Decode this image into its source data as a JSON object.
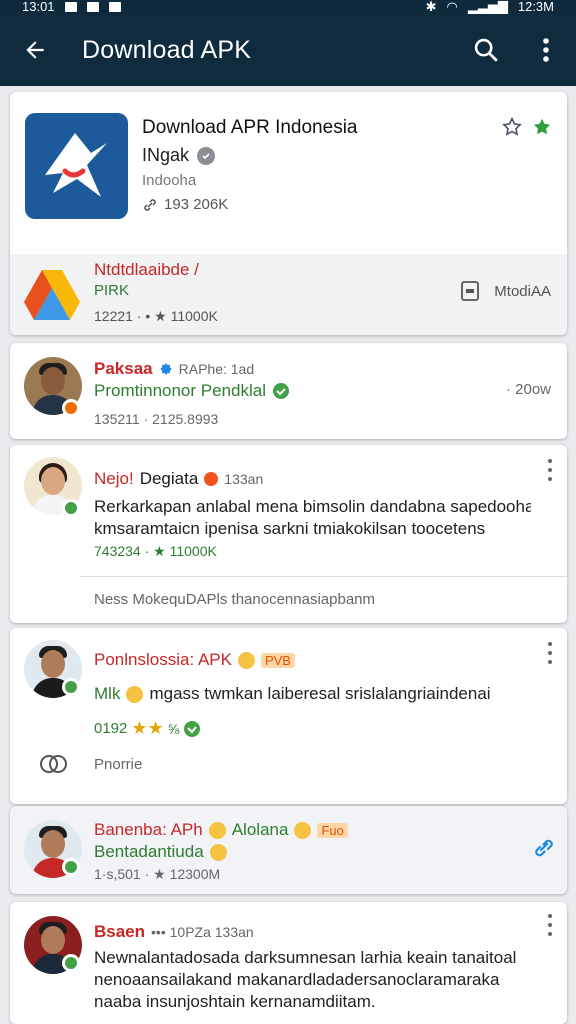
{
  "status_bar": {
    "time": "13:01",
    "right_time": "12:3M"
  },
  "app_bar": {
    "title": "Download APK"
  },
  "app_card": {
    "name": "Download APR Indonesia",
    "publisher": "INgak",
    "category": "Indooha",
    "size": "193 206K",
    "footer_title": "Ntdtdlaaibde /",
    "footer_sub": "PIRK",
    "footer_stats": "12221 · • ★ 11000K",
    "footer_right": "MtodiAA",
    "colors": {
      "icon_bg": "#1d5a9c",
      "star_green": "#2e9e3e"
    }
  },
  "reviews": [
    {
      "name": "Paksaa",
      "handle": "RAPhe: 1ad",
      "subtitle": "Promtinnonor Pendklal",
      "stats": "135211 · 2125.8993",
      "time": "· 20ow"
    },
    {
      "name_red": "Nejo!",
      "name_dark": "Degiata",
      "time": "133an",
      "line1": "Rerkarkapan anlabal mena bimsolin dandabna sapedooham",
      "line2": "kmsaramtaicn ipenisa sarkni tmiakokilsan toocetens",
      "stats": "743234 · ★ 11000K",
      "footer": "Ness MokequDAPls thanocennasiapbanm"
    },
    {
      "name_red": "Ponlnslossia: APK",
      "tag": "PVB",
      "line1": "Mlk",
      "line1_rest": "mgass twmkan laiberesal srislalangriaindenai",
      "stats": "0192",
      "footer": "Pnorrie"
    },
    {
      "name_red": "Banenba: APh",
      "name_dark": "Alolana",
      "tag": "Fuo",
      "subtitle": "Bentadantiuda",
      "stats": "1·s,501 · ★ 12300M"
    },
    {
      "name_red": "Bsaen",
      "handle": "••• 10PZa 133an",
      "line1": "Newnalantadosada darksumnesan larhia keain tanaitoal",
      "line2": "nenoaansailakand makanardladadersanoclaramaraka",
      "line3": "naaba insunjoshtain kernanamdiitam."
    }
  ]
}
